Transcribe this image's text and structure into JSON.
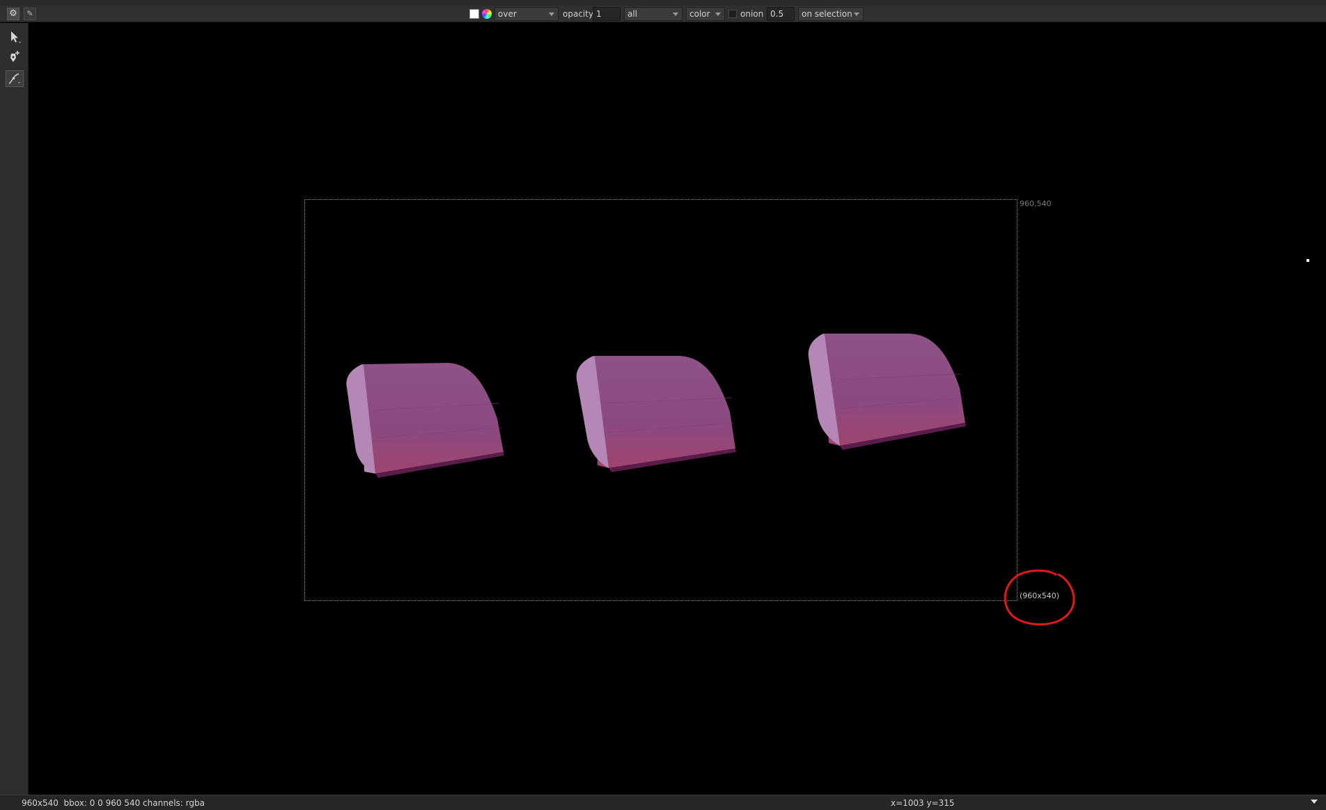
{
  "toolbar": {
    "merge_mode": "over",
    "opacity_label": "opacity",
    "opacity_value": "1",
    "layer": "all",
    "output": "color",
    "onion_label": "onion",
    "onion_value": "0.5",
    "transform_mode": "on selection"
  },
  "viewer": {
    "format_top_right": "960,540",
    "format_bottom_right": "(960x540)"
  },
  "status": {
    "info": "960x540  bbox: 0 0 960 540 channels: rgba",
    "coords": "x=1003 y=315"
  },
  "colors": {
    "shape_light": "#b07fb0",
    "shape_mid": "#8e4d86",
    "shape_dark": "#5e1f4e",
    "annotation": "#e01818"
  },
  "icons": {
    "settings": "gear-icon",
    "select_tool": "arrow-pointer-icon",
    "pen_tool": "pen-add-icon",
    "curve_tool": "curve-edit-icon"
  }
}
